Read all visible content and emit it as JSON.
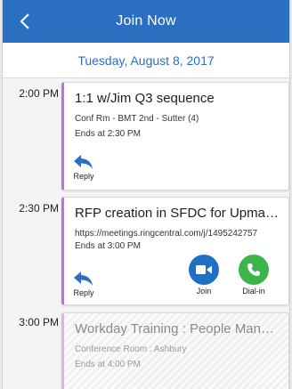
{
  "header": {
    "title": "Join Now",
    "back_icon": "chevron-left-icon",
    "bg_color": "#2a6fc0"
  },
  "date": "Tuesday, August 8, 2017",
  "accent_color": "#c070d8",
  "events": [
    {
      "time": "2:00 PM",
      "title": "1:1 w/Jim Q3 sequence",
      "lines": [
        "Conf Rm - BMT 2nd - Sutter (4)",
        "Ends at 2:30 PM"
      ],
      "actions": {
        "reply": "Reply"
      }
    },
    {
      "time": "2:30 PM",
      "title": "RFP creation in SFDC for Upmarket",
      "lines": [
        "https://meetings.ringcentral.com/j/1495242757",
        "Ends at 3:00 PM"
      ],
      "actions": {
        "reply": "Reply",
        "join": "Join",
        "dialin": "Dial-in"
      },
      "join_color": "#1f6fc5",
      "dialin_color": "#3ab54a"
    },
    {
      "time": "3:00 PM",
      "title": "Workday Training : People Management",
      "lines": [
        "Conference Room : Ashbury",
        "Ends at 4:00 PM"
      ]
    }
  ]
}
